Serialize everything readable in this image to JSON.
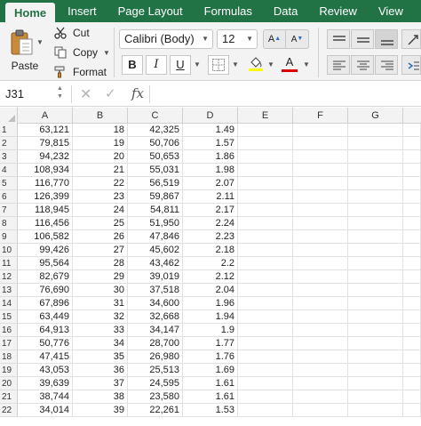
{
  "ribbon_tabs": [
    "Home",
    "Insert",
    "Page Layout",
    "Formulas",
    "Data",
    "Review",
    "View"
  ],
  "clipboard": {
    "paste_label": "Paste",
    "cut_label": "Cut",
    "copy_label": "Copy",
    "format_label": "Format"
  },
  "font": {
    "name": "Calibri (Body)",
    "size": "12",
    "bold_label": "B",
    "italic_label": "I",
    "underline_label": "U",
    "font_color_label": "A",
    "fill_color": "#ffff00",
    "font_color": "#e00000"
  },
  "formula_bar": {
    "name_box": "J31",
    "fx_label": "fx"
  },
  "columns": [
    "A",
    "B",
    "C",
    "D",
    "E",
    "F",
    "G"
  ],
  "rows": [
    {
      "n": "1",
      "A": "63,121",
      "B": "18",
      "C": "42,325",
      "D": "1.49"
    },
    {
      "n": "2",
      "A": "79,815",
      "B": "19",
      "C": "50,706",
      "D": "1.57"
    },
    {
      "n": "3",
      "A": "94,232",
      "B": "20",
      "C": "50,653",
      "D": "1.86"
    },
    {
      "n": "4",
      "A": "108,934",
      "B": "21",
      "C": "55,031",
      "D": "1.98"
    },
    {
      "n": "5",
      "A": "116,770",
      "B": "22",
      "C": "56,519",
      "D": "2.07"
    },
    {
      "n": "6",
      "A": "126,399",
      "B": "23",
      "C": "59,867",
      "D": "2.11"
    },
    {
      "n": "7",
      "A": "118,945",
      "B": "24",
      "C": "54,811",
      "D": "2.17"
    },
    {
      "n": "8",
      "A": "116,456",
      "B": "25",
      "C": "51,950",
      "D": "2.24"
    },
    {
      "n": "9",
      "A": "106,582",
      "B": "26",
      "C": "47,846",
      "D": "2.23"
    },
    {
      "n": "10",
      "A": "99,426",
      "B": "27",
      "C": "45,602",
      "D": "2.18"
    },
    {
      "n": "11",
      "A": "95,564",
      "B": "28",
      "C": "43,462",
      "D": "2.2"
    },
    {
      "n": "12",
      "A": "82,679",
      "B": "29",
      "C": "39,019",
      "D": "2.12"
    },
    {
      "n": "13",
      "A": "76,690",
      "B": "30",
      "C": "37,518",
      "D": "2.04"
    },
    {
      "n": "14",
      "A": "67,896",
      "B": "31",
      "C": "34,600",
      "D": "1.96"
    },
    {
      "n": "15",
      "A": "63,449",
      "B": "32",
      "C": "32,668",
      "D": "1.94"
    },
    {
      "n": "16",
      "A": "64,913",
      "B": "33",
      "C": "34,147",
      "D": "1.9"
    },
    {
      "n": "17",
      "A": "50,776",
      "B": "34",
      "C": "28,700",
      "D": "1.77"
    },
    {
      "n": "18",
      "A": "47,415",
      "B": "35",
      "C": "26,980",
      "D": "1.76"
    },
    {
      "n": "19",
      "A": "43,053",
      "B": "36",
      "C": "25,513",
      "D": "1.69"
    },
    {
      "n": "20",
      "A": "39,639",
      "B": "37",
      "C": "24,595",
      "D": "1.61"
    },
    {
      "n": "21",
      "A": "38,744",
      "B": "38",
      "C": "23,580",
      "D": "1.61"
    },
    {
      "n": "22",
      "A": "34,014",
      "B": "39",
      "C": "22,261",
      "D": "1.53"
    }
  ]
}
